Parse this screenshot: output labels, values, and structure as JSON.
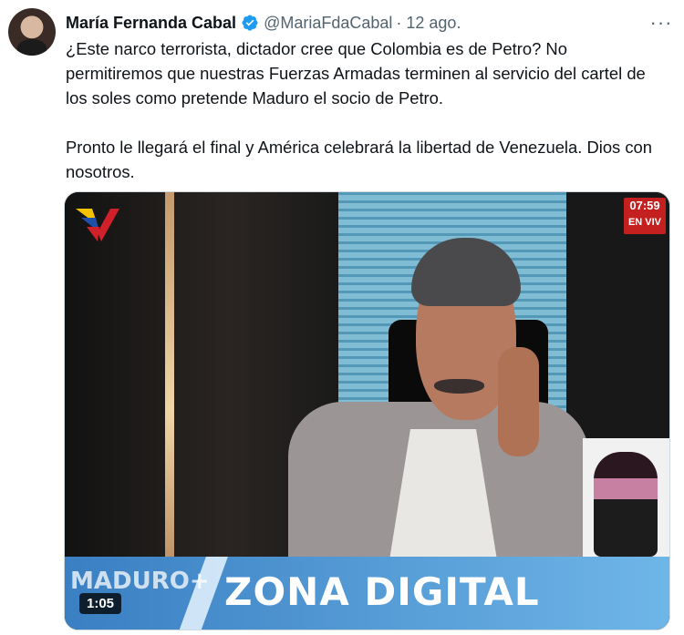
{
  "tweet": {
    "author_name": "María Fernanda Cabal",
    "handle": "@MariaFdaCabal",
    "separator": "·",
    "date": "12 ago.",
    "more_label": "···",
    "paragraphs": [
      "¿Este narco terrorista, dictador cree que Colombia es de Petro? No permitiremos que nuestras Fuerzas Armadas terminen al servicio del cartel de los soles como pretende Maduro el socio de Petro.",
      "Pronto le llegará el final y América celebrará la libertad de Venezuela. Dios con nosotros."
    ]
  },
  "video": {
    "duration": "1:05",
    "banner_text": "ZONA DIGITAL",
    "banner_side_text": "MADURO+",
    "clock_time": "07:59",
    "clock_live": "EN VIV",
    "accent_color": "#1d9bf0"
  },
  "icons": {
    "verified": "verified-badge-icon",
    "more": "more-options-icon"
  }
}
